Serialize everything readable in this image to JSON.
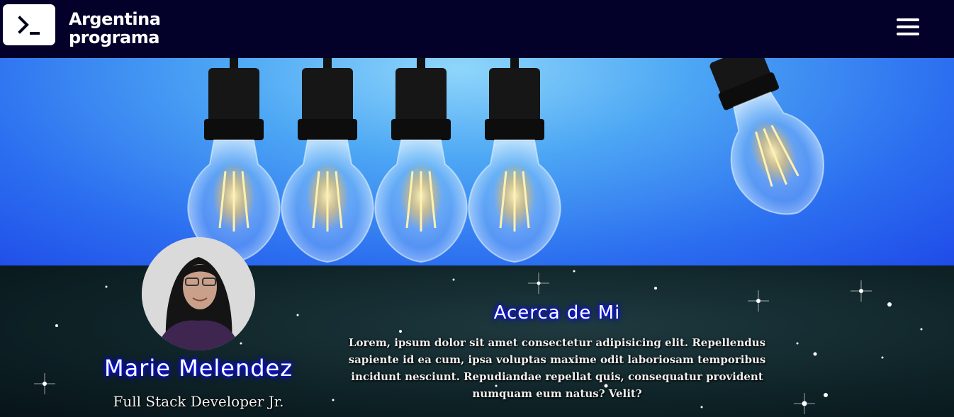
{
  "header": {
    "brand_line1": "Argentina",
    "brand_line2": "programa",
    "logo_icon": "terminal-prompt-icon",
    "menu_icon": "hamburger-menu-icon",
    "background_color": "#03002a"
  },
  "hero": {
    "image": "hanging-light-bulbs",
    "background_color": "#2c6ff0"
  },
  "profile": {
    "name": "Marie Melendez",
    "role": "Full Stack Developer Jr."
  },
  "about": {
    "title": "Acerca de Mi",
    "text": "Lorem, ipsum dolor sit amet consectetur adipisicing elit. Repellendus sapiente id ea cum, ipsa voluptas maxime odit laboriosam temporibus incidunt nesciunt. Repudiandae repellat quis, consequatur provident numquam eum natus? Velit?",
    "background": "dark-starry-sky"
  },
  "colors": {
    "title_glow": "#1010ff",
    "text": "#ffffff"
  }
}
